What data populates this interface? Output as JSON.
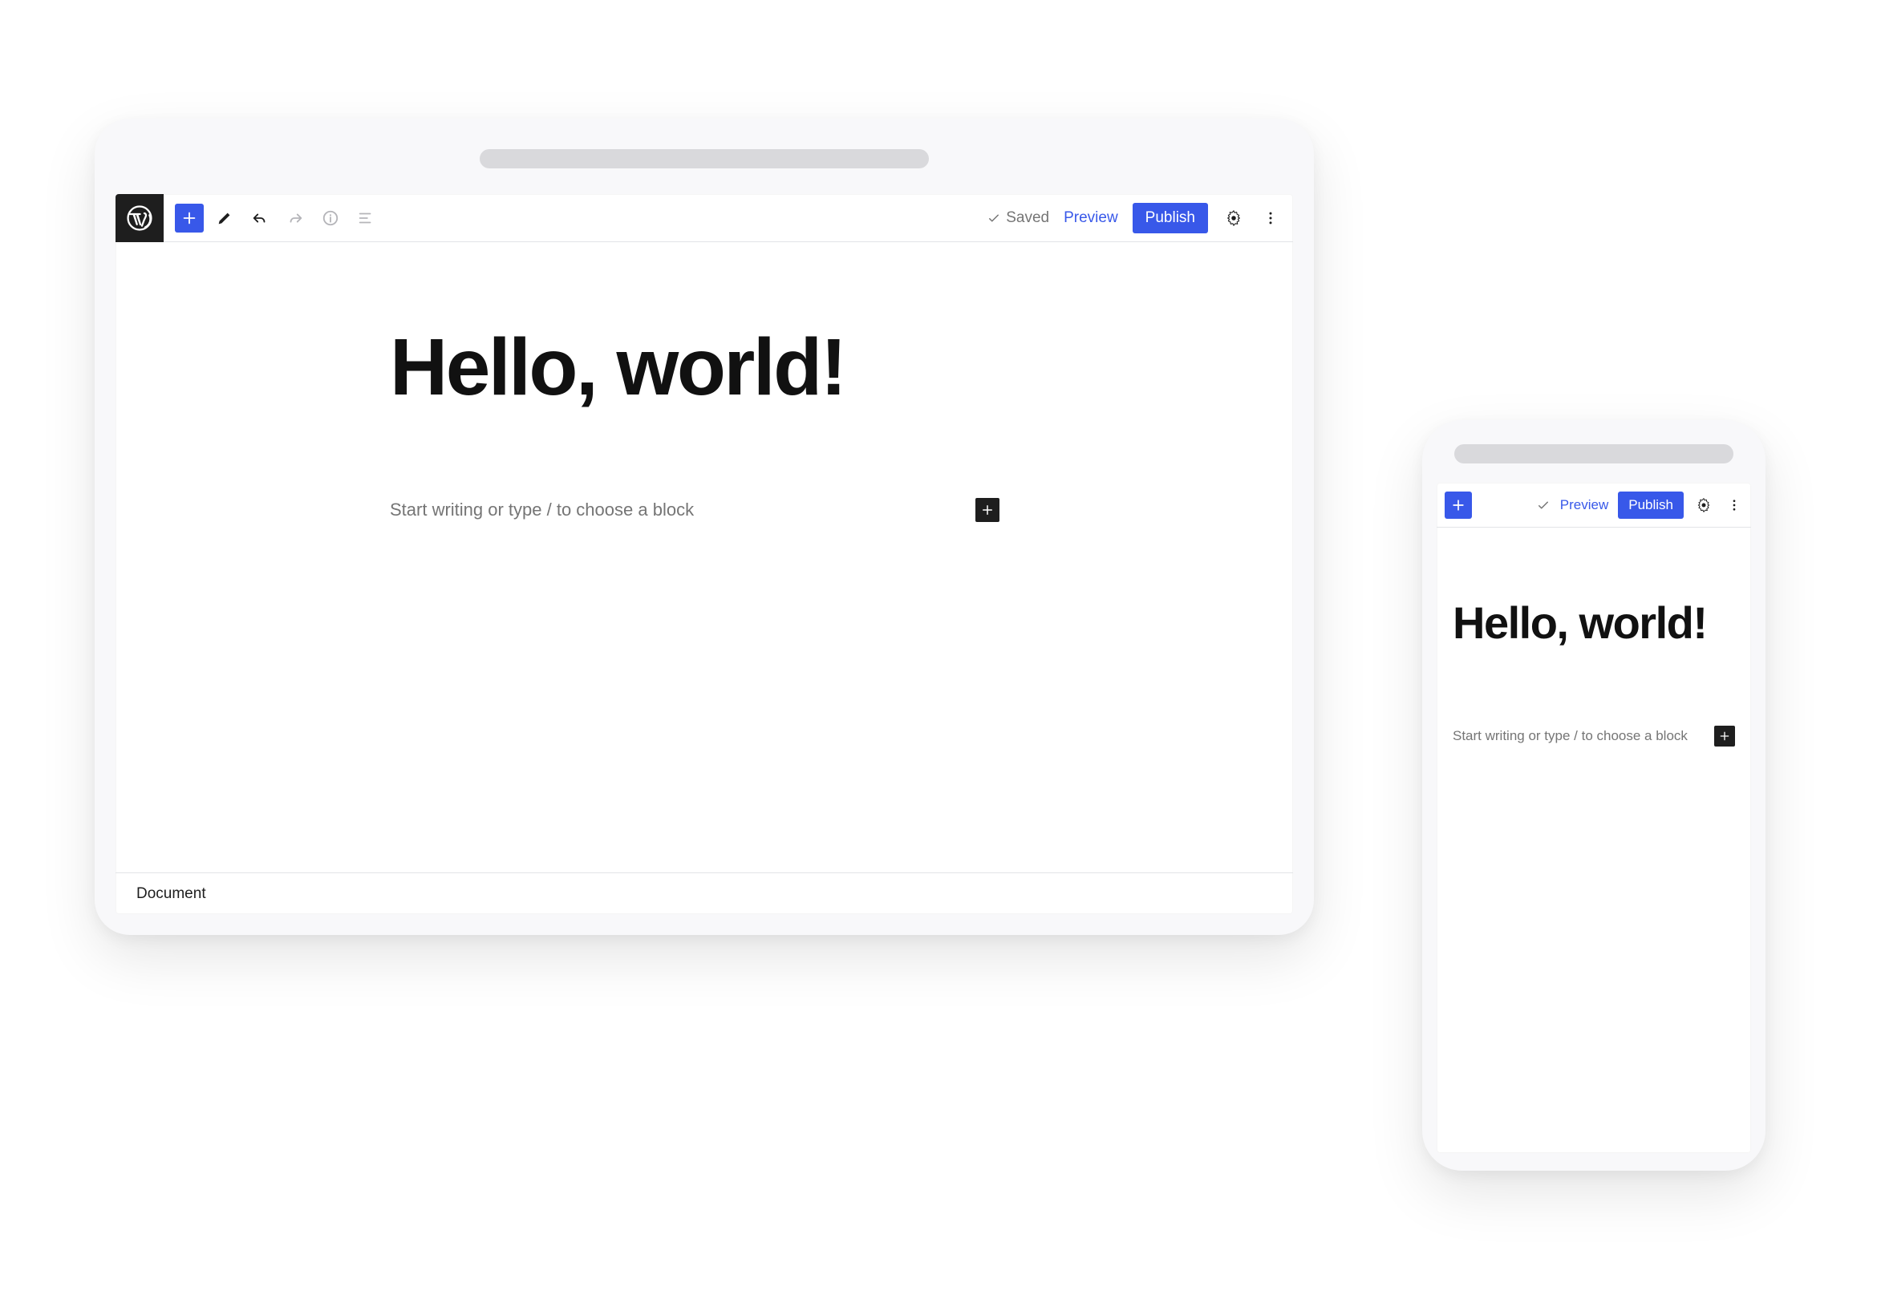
{
  "tablet": {
    "toolbar": {
      "saved_label": "Saved",
      "preview_label": "Preview",
      "publish_label": "Publish"
    },
    "editor": {
      "title": "Hello, world!",
      "placeholder": "Start writing or type / to choose a block"
    },
    "footer": {
      "breadcrumb": "Document"
    }
  },
  "phone": {
    "toolbar": {
      "preview_label": "Preview",
      "publish_label": "Publish"
    },
    "editor": {
      "title": "Hello, world!",
      "placeholder": "Start writing or type / to choose a block"
    }
  },
  "colors": {
    "accent": "#3858e9",
    "dark": "#1e1e1e",
    "muted": "#757575"
  }
}
